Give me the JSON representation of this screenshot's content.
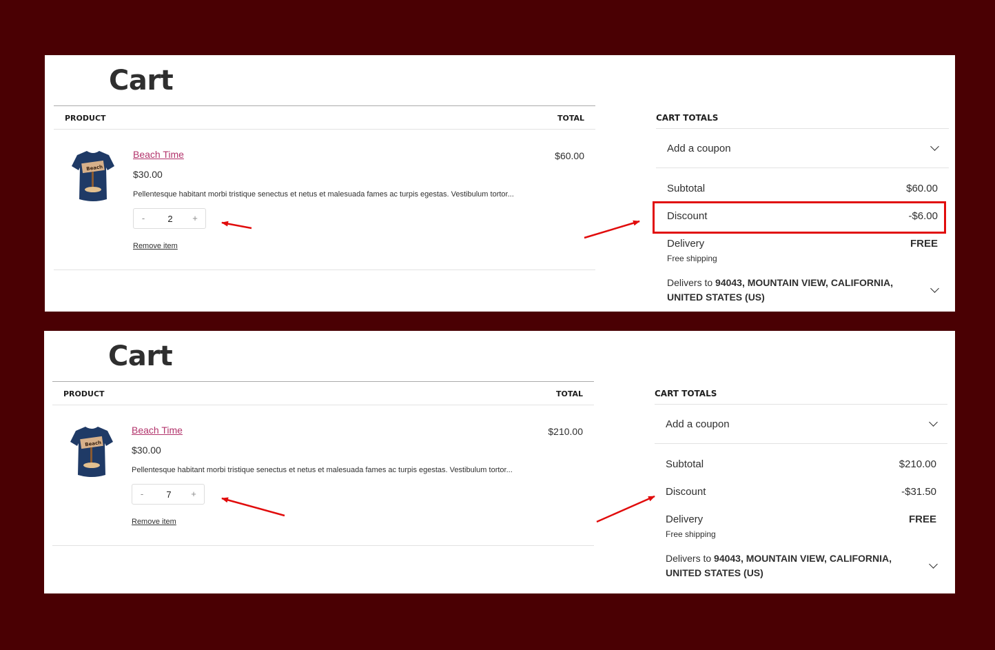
{
  "panels": [
    {
      "title": "Cart",
      "table": {
        "col_product": "PRODUCT",
        "col_total": "TOTAL"
      },
      "item": {
        "name": "Beach Time",
        "unit_price": "$30.00",
        "description": "Pellentesque habitant morbi tristique senectus et netus et malesuada fames ac turpis egestas. Vestibulum tortor...",
        "qty_minus": "-",
        "quantity": "2",
        "qty_plus": "+",
        "remove_label": "Remove item",
        "line_total": "$60.00"
      },
      "totals": {
        "heading": "CART TOTALS",
        "coupon_label": "Add a coupon",
        "subtotal_label": "Subtotal",
        "subtotal_value": "$60.00",
        "discount_label": "Discount",
        "discount_value": "-$6.00",
        "delivery_label": "Delivery",
        "delivery_value": "FREE",
        "delivery_note": "Free shipping",
        "delivers_prefix": "Delivers to ",
        "delivers_address": "94043, MOUNTAIN VIEW, CALIFORNIA, UNITED STATES (US)"
      }
    },
    {
      "title": "Cart",
      "table": {
        "col_product": "PRODUCT",
        "col_total": "TOTAL"
      },
      "item": {
        "name": "Beach Time",
        "unit_price": "$30.00",
        "description": "Pellentesque habitant morbi tristique senectus et netus et malesuada fames ac turpis egestas. Vestibulum tortor...",
        "qty_minus": "-",
        "quantity": "7",
        "qty_plus": "+",
        "remove_label": "Remove item",
        "line_total": "$210.00"
      },
      "totals": {
        "heading": "CART TOTALS",
        "coupon_label": "Add a coupon",
        "subtotal_label": "Subtotal",
        "subtotal_value": "$210.00",
        "discount_label": "Discount",
        "discount_value": "-$31.50",
        "delivery_label": "Delivery",
        "delivery_value": "FREE",
        "delivery_note": "Free shipping",
        "delivers_prefix": "Delivers to ",
        "delivers_address": "94043, MOUNTAIN VIEW, CALIFORNIA, UNITED STATES (US)"
      }
    }
  ],
  "colors": {
    "page_background": "#4a0003",
    "product_link": "#b2336b",
    "annotation_red": "#e10c0c",
    "tshirt_navy": "#1f3a66"
  },
  "annotations": {
    "discount_highlight_panel": 1,
    "arrows": "red arrows pointing to quantity stepper and discount row"
  }
}
